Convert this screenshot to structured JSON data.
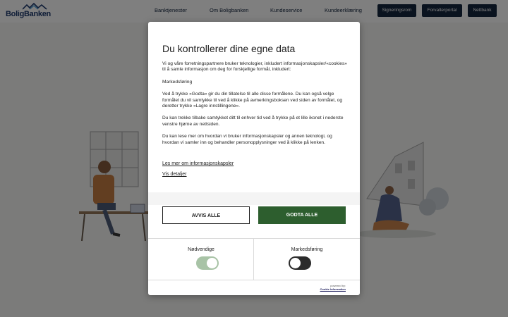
{
  "header": {
    "logo_text": "BoligBanken",
    "nav": [
      "Banktjenester",
      "Om Boligbanken",
      "Kundeservice",
      "Kundeerklæring"
    ],
    "buttons": [
      "Signeringsrom",
      "Forvalterportal",
      "Nettbank"
    ]
  },
  "consent": {
    "title": "Du kontrollerer dine egne data",
    "paragraphs": [
      "Vi og våre forretningspartnere bruker teknologier, inkludert informasjonskapsler/«cookies» til å samle informasjon om deg for forskjellige formål, inkludert:",
      "Markedsføring",
      "Ved å trykke «Godta» gir du din tillatelse til alle disse formålene. Du kan også velge formålet du vil samtykke til ved å klikke på avmerkingsboksen ved siden av formålet, og deretter trykke «Lagre innstillingene».",
      "Du kan trekke tilbake samtykket ditt til enhver tid ved å trykke på et lille ikonet i nederste venstre hjørne av nettsiden.",
      "Du kan lese mer om hvordan vi bruker informasjonskapsler og annen teknologi, og hvordan vi samler inn og behandler personopplysninger ved å klikke på lenken."
    ],
    "link_more": "Les mer om informasjonskapsler",
    "link_details": "Vis detaljer",
    "btn_reject": "AVVIS ALLE",
    "btn_accept": "GODTA ALLE",
    "toggles": [
      {
        "label": "Nødvendige",
        "state": "on-disabled"
      },
      {
        "label": "Markedsføring",
        "state": "off"
      }
    ],
    "powered_by": "powered by:",
    "powered_name": "Cookie Information"
  },
  "colors": {
    "accent_green": "#2d5e2e",
    "navy": "#15263f",
    "toggle_on_disabled": "#a8c3a6",
    "toggle_off": "#2b2b2b"
  }
}
